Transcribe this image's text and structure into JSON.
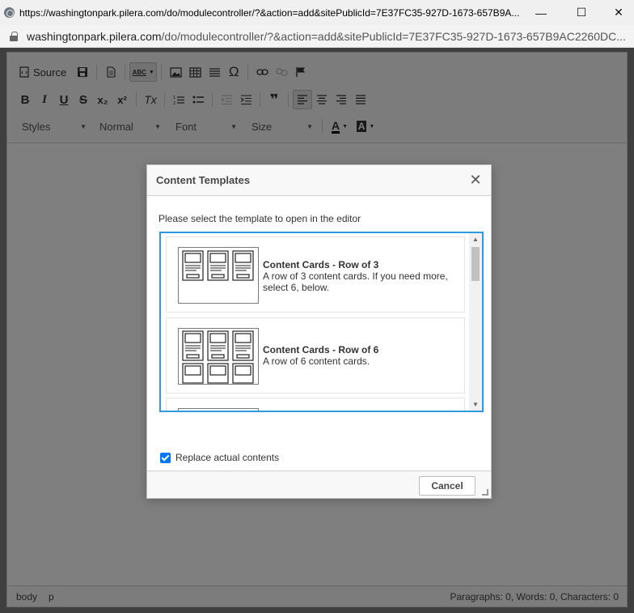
{
  "browser": {
    "window_url": "https://washingtonpark.pilera.com/do/modulecontroller/?&action=add&sitePublicId=7E37FC35-927D-1673-657B9A...",
    "address_domain": "washingtonpark.pilera.com",
    "address_path": "/do/modulecontroller/?&action=add&sitePublicId=7E37FC35-927D-1673-657B9AC2260DC...",
    "window_controls": {
      "minimize": "—",
      "maximize": "☐",
      "close": "✕"
    }
  },
  "toolbar": {
    "source_label": "Source",
    "styles_label": "Styles",
    "format_label": "Normal",
    "font_label": "Font",
    "size_label": "Size",
    "spell_label": "ABC",
    "icons": [
      "save-icon",
      "new-page-icon",
      "spellcheck-icon",
      "image-icon",
      "table-icon",
      "horizontal-line-icon",
      "special-char-icon",
      "link-icon",
      "unlink-icon",
      "anchor-icon",
      "bold-icon",
      "italic-icon",
      "underline-icon",
      "strikethrough-icon",
      "subscript-icon",
      "superscript-icon",
      "remove-format-icon",
      "numbered-list-icon",
      "bulleted-list-icon",
      "outdent-icon",
      "indent-icon",
      "blockquote-icon",
      "align-left-icon",
      "align-center-icon",
      "align-right-icon",
      "justify-icon",
      "text-color-icon",
      "background-color-icon"
    ],
    "glyphs": {
      "bold": "B",
      "italic": "I",
      "underline": "U",
      "strike": "S",
      "sub": "x₂",
      "sup": "x²",
      "remove_format": "Tx",
      "omega": "Ω",
      "quote": "❞",
      "text_color": "A",
      "bg_color": "A"
    }
  },
  "dialog": {
    "title": "Content Templates",
    "close_glyph": "✕",
    "prompt": "Please select the template to open in the editor",
    "templates": [
      {
        "title": "Content Cards - Row of 3",
        "description": "A row of 3 content cards. If you need more, select 6, below."
      },
      {
        "title": "Content Cards - Row of 6",
        "description": "A row of 6 content cards."
      }
    ],
    "replace_label": "Replace actual contents",
    "replace_checked": true,
    "cancel_label": "Cancel"
  },
  "statusbar": {
    "path": [
      "body",
      "p"
    ],
    "counts": "Paragraphs: 0, Words: 0, Characters: 0"
  },
  "colors": {
    "accent": "#2e9be0",
    "checkbox": "#0075ff",
    "overlay": "rgba(0,0,0,0.5)"
  }
}
